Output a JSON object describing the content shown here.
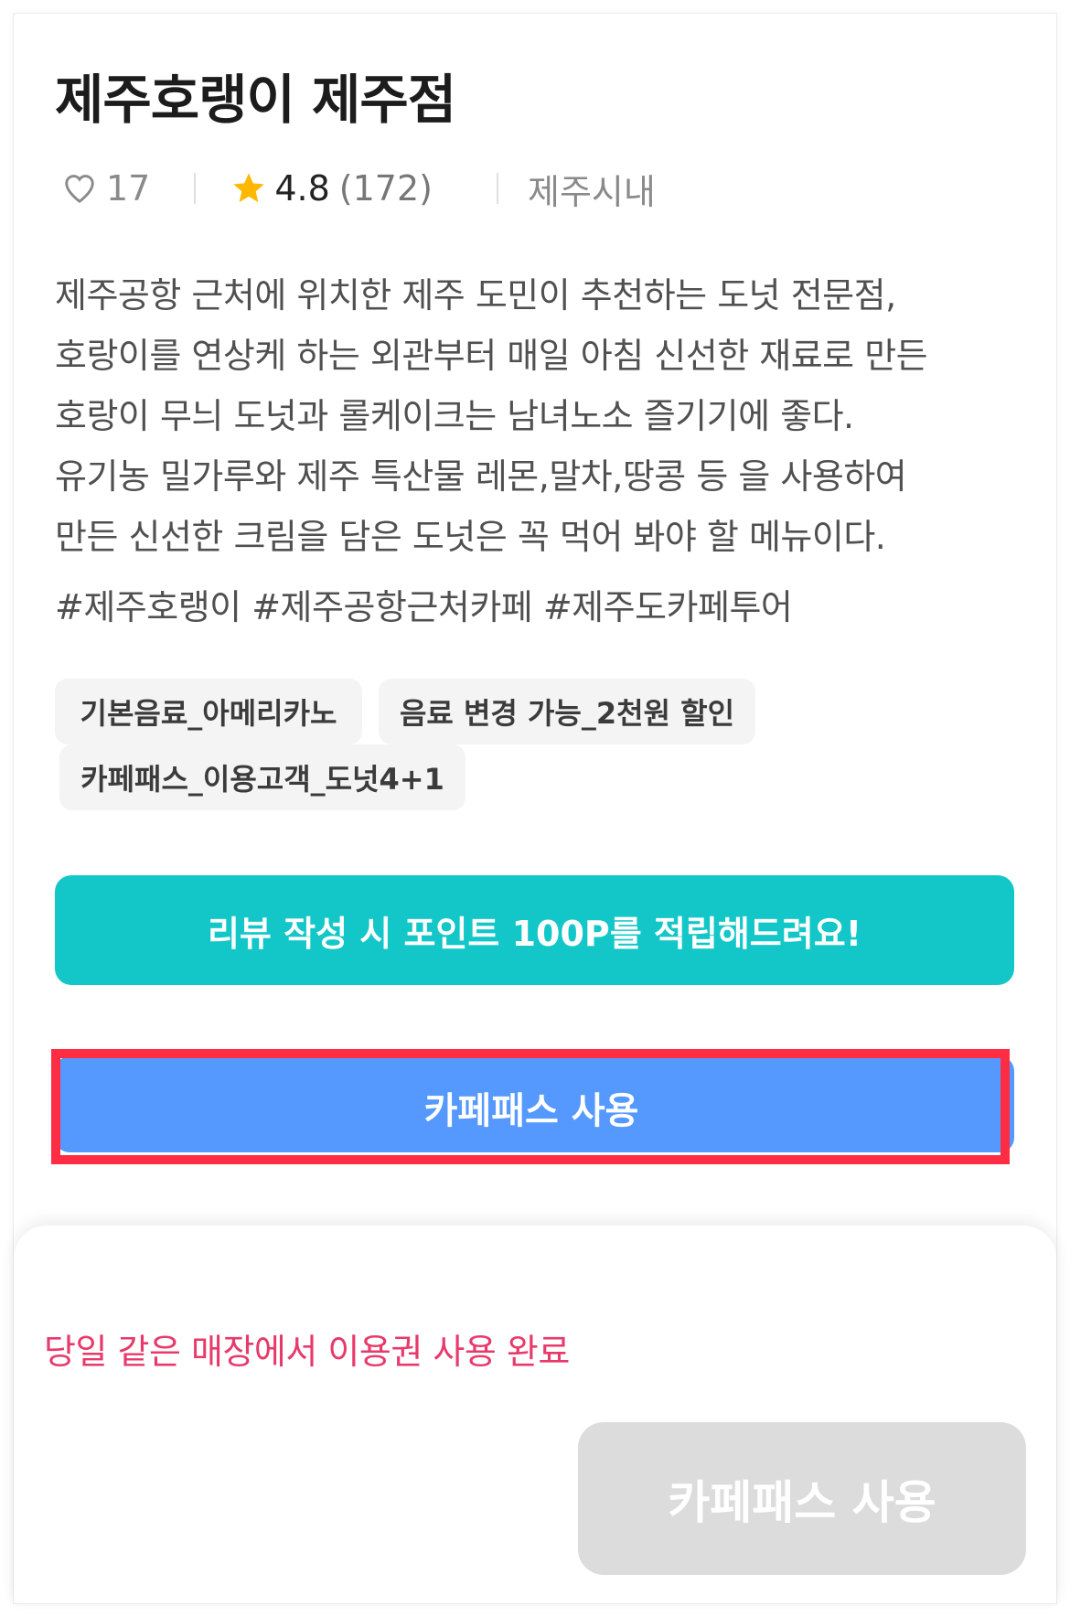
{
  "store": {
    "title": "제주호랭이 제주점",
    "likes": "17",
    "rating": "4.8",
    "review_count": "(172)",
    "region": "제주시내"
  },
  "description": {
    "lines": [
      "제주공항 근처에 위치한 제주 도민이 추천하는 도넛 전문점,",
      "호랑이를 연상케 하는 외관부터 매일 아침 신선한 재료로 만든",
      "호랑이 무늬 도넛과 롤케이크는 남녀노소 즐기기에 좋다.",
      "유기농 밀가루와 제주 특산물 레몬,말차,땅콩 등 을 사용하여",
      "만든 신선한 크림을 담은 도넛은 꼭 먹어 봐야 할 메뉴이다."
    ],
    "hashtags": "#제주호랭이 #제주공항근처카페 #제주도카페투어"
  },
  "tags": [
    "기본음료_아메리카노",
    "음료 변경 가능_2천원 할인",
    "카페패스_이용고객_도넛4+1"
  ],
  "actions": {
    "review_banner": "리뷰 작성 시 포인트 100P를 적립해드려요!",
    "cafepass_button": "카페패스 사용"
  },
  "bottom_sheet": {
    "notice": "당일 같은 매장에서 이용권 사용 완료",
    "disabled_button": "카페패스 사용"
  },
  "colors": {
    "review_banner": "#13c7c9",
    "cafepass_button": "#5599ff",
    "highlight": "#ff2d43",
    "notice": "#e8396b",
    "star": "#ffb800"
  },
  "icons": [
    "heart-icon",
    "star-icon"
  ]
}
